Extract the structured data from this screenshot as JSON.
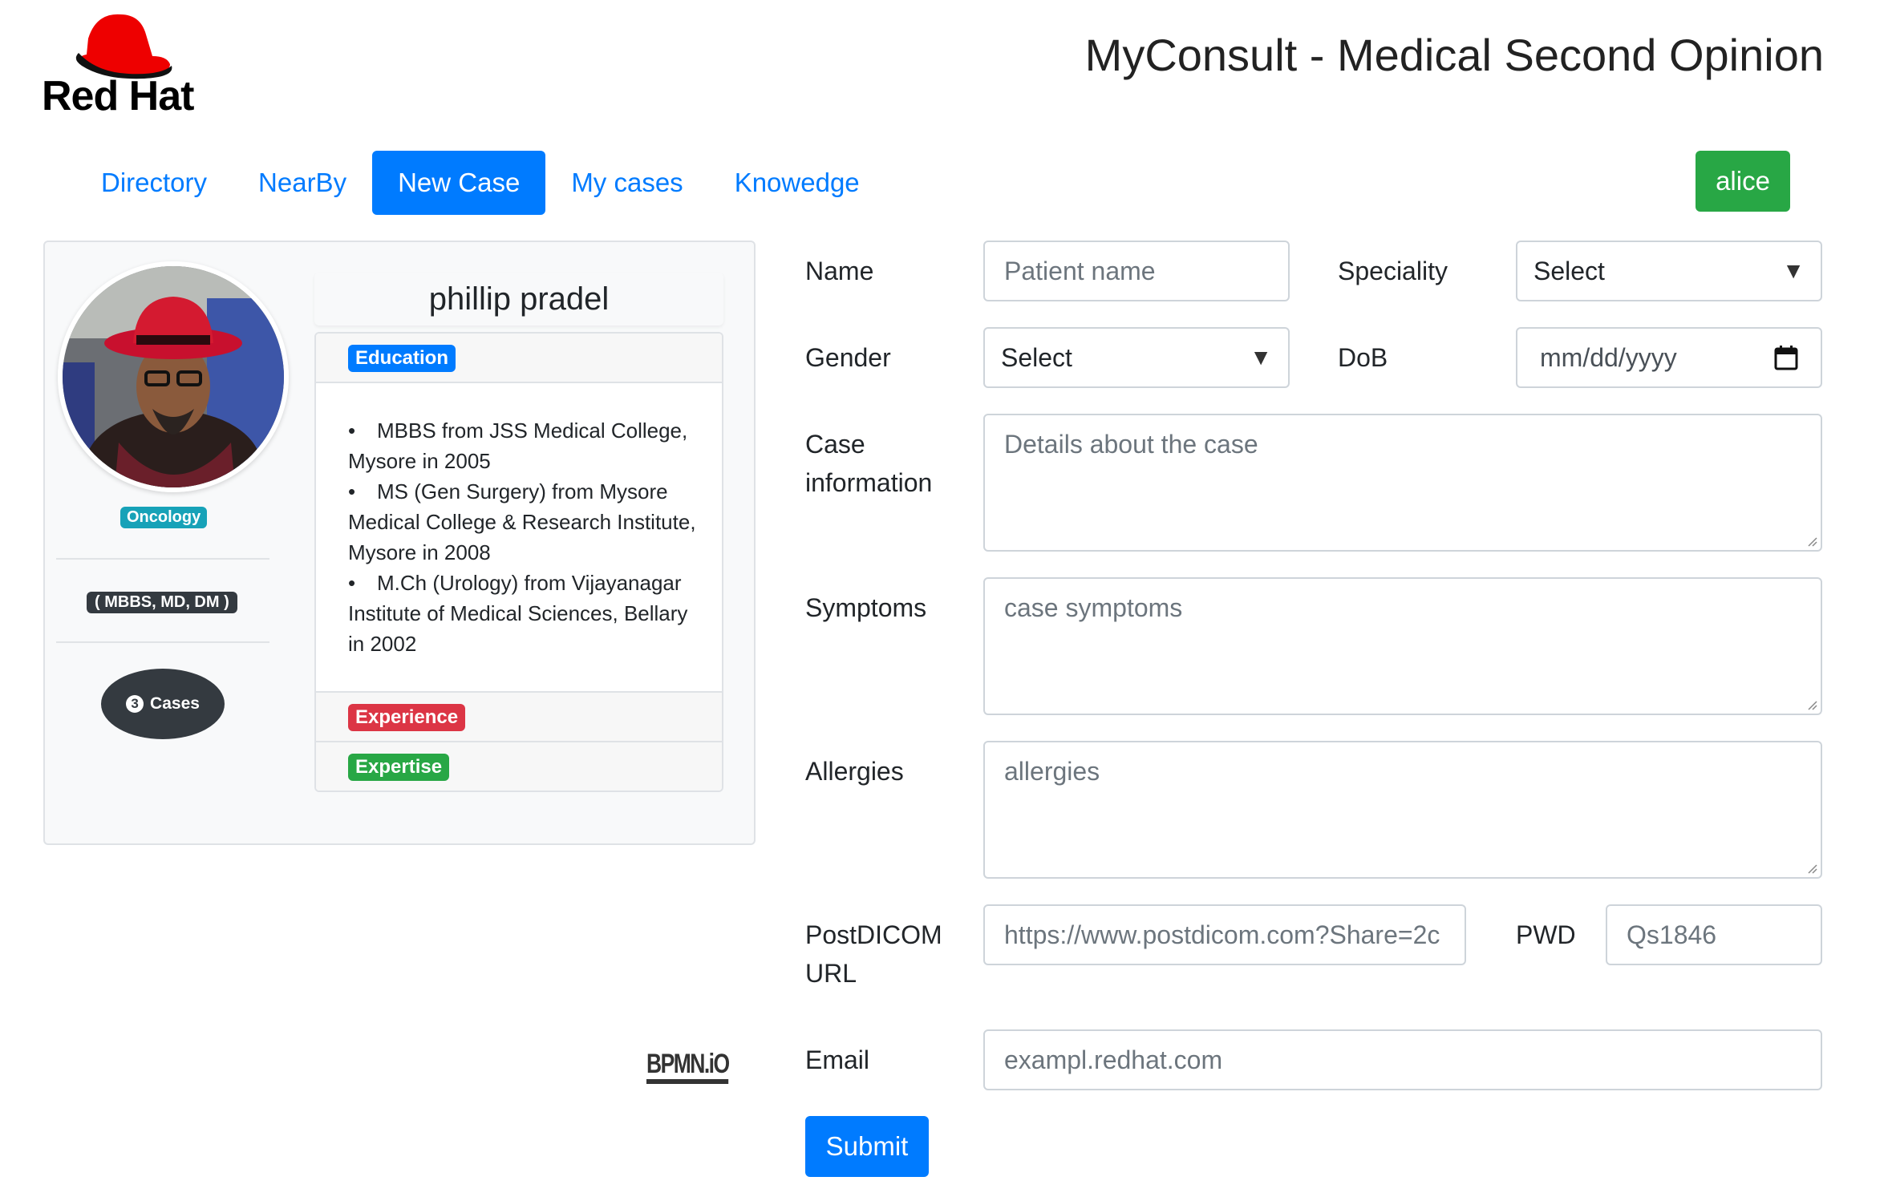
{
  "header": {
    "logo_text": "Red Hat",
    "app_title": "MyConsult - Medical Second Opinion"
  },
  "nav": {
    "items": [
      {
        "label": "Directory",
        "active": false
      },
      {
        "label": "NearBy",
        "active": false
      },
      {
        "label": "New Case",
        "active": true
      },
      {
        "label": "My cases",
        "active": false
      },
      {
        "label": "Knowedge",
        "active": false
      }
    ],
    "user_label": "alice"
  },
  "profile": {
    "name": "phillip pradel",
    "speciality": "Oncology",
    "degrees": "( MBBS, MD, DM )",
    "cases_count": "3",
    "cases_label": "Cases",
    "education_label": "Education",
    "education": [
      "MBBS from JSS Medical College, Mysore in 2005",
      "MS (Gen Surgery) from Mysore Medical College & Research Institute, Mysore in 2008",
      "M.Ch (Urology) from Vijayanagar Institute of Medical Sciences, Bellary in 2002"
    ],
    "experience_label": "Experience",
    "expertise_label": "Expertise"
  },
  "footer_logo": "BPMN.iO",
  "form": {
    "name": {
      "label": "Name",
      "placeholder": "Patient name"
    },
    "speciality": {
      "label": "Speciality",
      "value": "Select"
    },
    "gender": {
      "label": "Gender",
      "value": "Select"
    },
    "dob": {
      "label": "DoB",
      "placeholder": "mm/dd/yyyy"
    },
    "case_info": {
      "label_line1": "Case",
      "label_line2": "information",
      "placeholder": "Details about the case"
    },
    "symptoms": {
      "label": "Symptoms",
      "placeholder": "case symptoms"
    },
    "allergies": {
      "label": "Allergies",
      "placeholder": "allergies"
    },
    "postdicom": {
      "label_line1": "PostDICOM",
      "label_line2": "URL",
      "placeholder": "https://www.postdicom.com?Share=2c"
    },
    "pwd": {
      "label": "PWD",
      "placeholder": "Qs1846"
    },
    "email": {
      "label": "Email",
      "placeholder": "exampl.redhat.com"
    },
    "submit_label": "Submit"
  },
  "colors": {
    "primary": "#007bff",
    "success": "#28a745",
    "info": "#17a2b8",
    "danger": "#dc3545",
    "dark": "#343a40",
    "brand_red": "#ee0000"
  }
}
